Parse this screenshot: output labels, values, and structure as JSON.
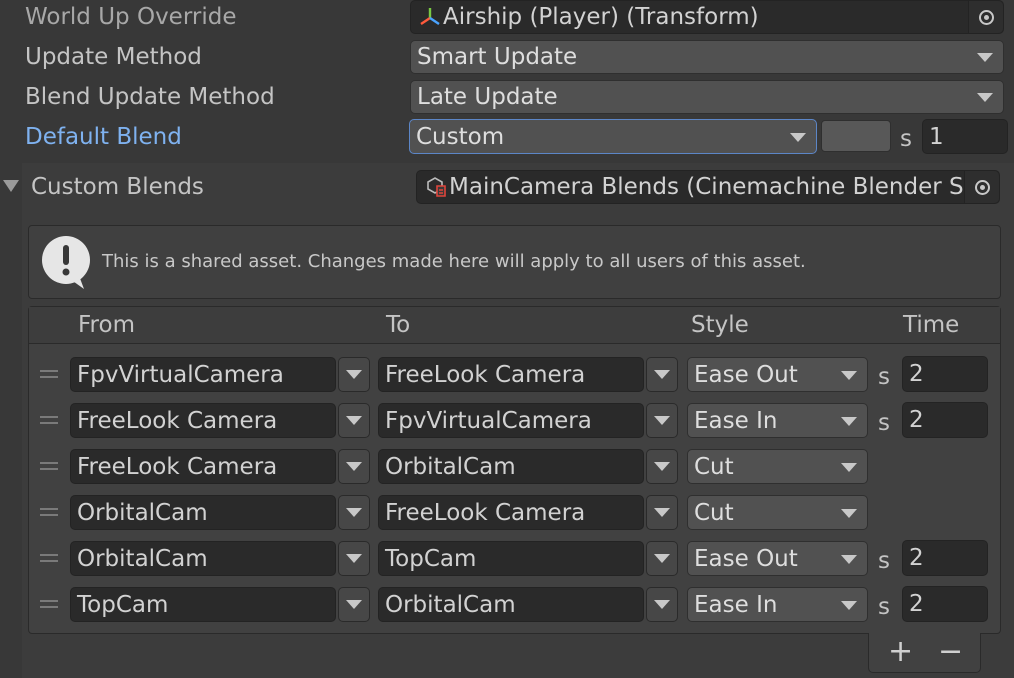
{
  "inspector": {
    "world_up_override": {
      "label": "World Up Override",
      "value": "Airship (Player) (Transform)",
      "icon": "transform-icon"
    },
    "update_method": {
      "label": "Update Method",
      "value": "Smart Update"
    },
    "blend_update_method": {
      "label": "Blend Update Method",
      "value": "Late Update"
    },
    "default_blend": {
      "label": "Default Blend",
      "style": "Custom",
      "unit": "s",
      "time": "1"
    },
    "custom_blends": {
      "label": "Custom Blends",
      "value": "MainCamera Blends (Cinemachine Blender S",
      "icon": "scriptable-object-icon"
    }
  },
  "shared_notice": {
    "text": "This is a shared asset.  Changes made here will apply to all users of this asset.",
    "icon": "warning-speech-icon"
  },
  "blends_table": {
    "headers": {
      "from": "From",
      "to": "To",
      "style": "Style",
      "time": "Time"
    },
    "unit": "s",
    "rows": [
      {
        "from": "FpvVirtualCamera",
        "to": "FreeLook Camera",
        "style": "Ease Out",
        "time": "2"
      },
      {
        "from": "FreeLook Camera",
        "to": "FpvVirtualCamera",
        "style": "Ease In",
        "time": "2"
      },
      {
        "from": "FreeLook Camera",
        "to": "OrbitalCam",
        "style": "Cut",
        "time": ""
      },
      {
        "from": "OrbitalCam",
        "to": "FreeLook Camera",
        "style": "Cut",
        "time": ""
      },
      {
        "from": "OrbitalCam",
        "to": "TopCam",
        "style": "Ease Out",
        "time": "2"
      },
      {
        "from": "TopCam",
        "to": "OrbitalCam",
        "style": "Ease In",
        "time": "2"
      }
    ],
    "add_label": "+",
    "remove_label": "−"
  },
  "colors": {
    "accent_label": "#7fb2f0",
    "background": "#383838",
    "field": "#2a2a2a"
  }
}
